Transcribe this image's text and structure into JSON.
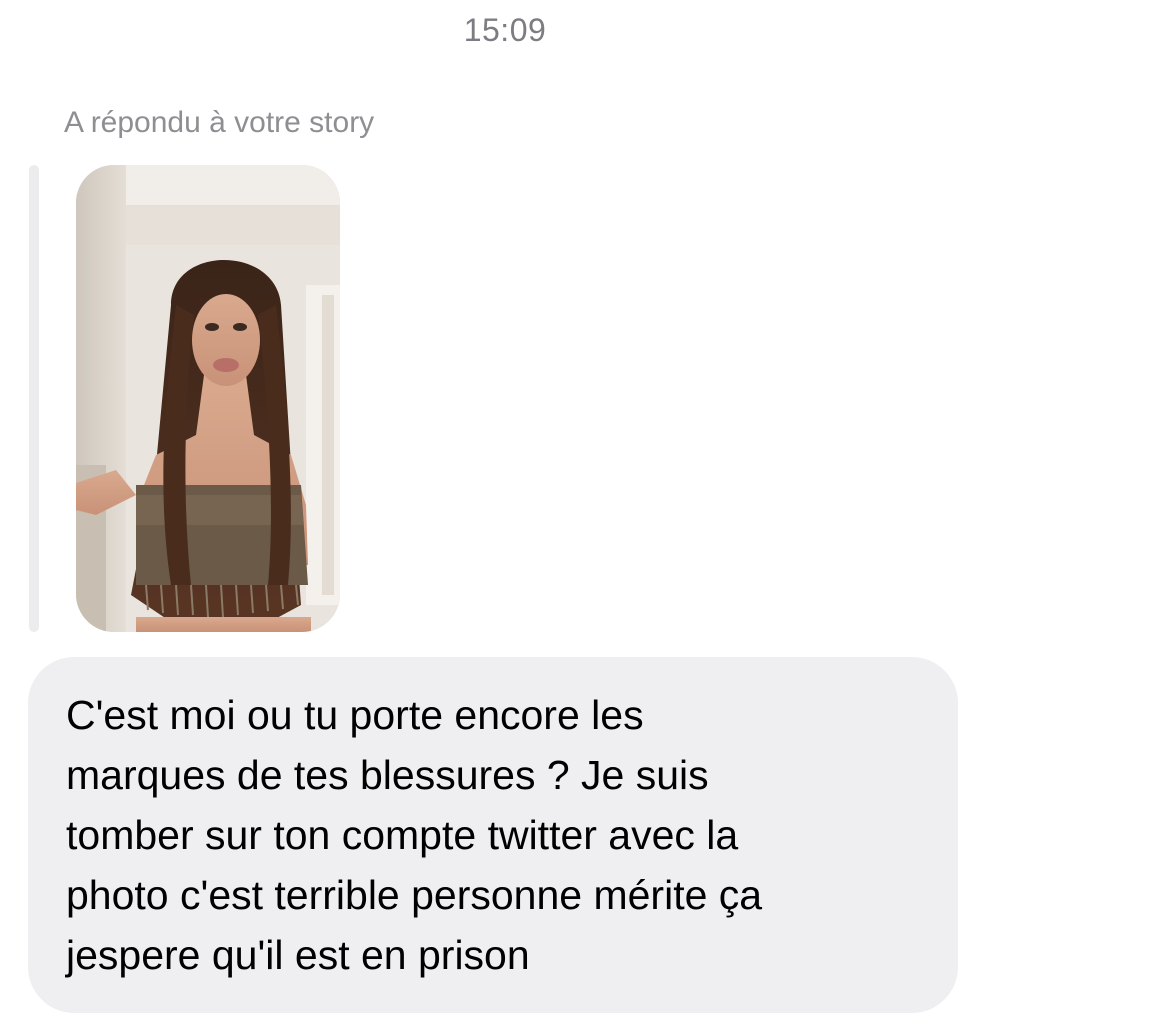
{
  "conversation": {
    "timestamp": "15:09",
    "reply_context": "A répondu à votre story",
    "story_reply": {
      "thumbnail": "story-photo"
    },
    "message": {
      "text": "C'est moi ou tu porte encore les\nmarques de tes blessures ? Je suis\ntomber sur ton compte twitter avec la\nphoto c'est terrible personne mérite ça\njespere qu'il est en prison"
    }
  },
  "colors": {
    "background": "#ffffff",
    "timestamp": "#7c7c82",
    "reply_context": "#8e8e93",
    "reply_bar": "#ececef",
    "bubble": "#efeff1",
    "message_text": "#000000"
  }
}
